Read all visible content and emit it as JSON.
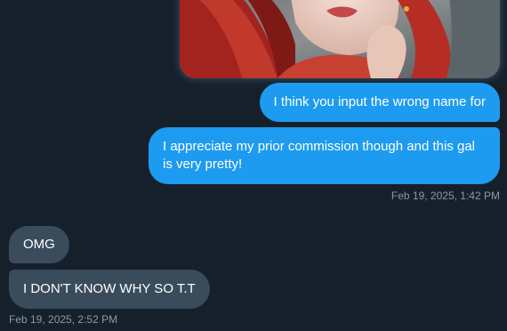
{
  "conversation": {
    "attachment": {
      "type": "image",
      "description_icon": "portrait-image-icon"
    },
    "sent_messages": [
      {
        "text": "I think you input the wrong name for"
      },
      {
        "text": "I appreciate my prior commission though and this gal is very pretty!"
      }
    ],
    "sent_timestamp": "Feb 19, 2025, 1:42 PM",
    "received_messages": [
      {
        "text": "OMG"
      },
      {
        "text": "I DON'T KNOW WHY SO T.T"
      }
    ],
    "received_timestamp": "Feb 19, 2025, 2:52 PM"
  },
  "colors": {
    "background": "#15202b",
    "sent_bubble": "#1d9bf0",
    "received_bubble": "#3a4b5c",
    "timestamp": "#8b98a5"
  }
}
